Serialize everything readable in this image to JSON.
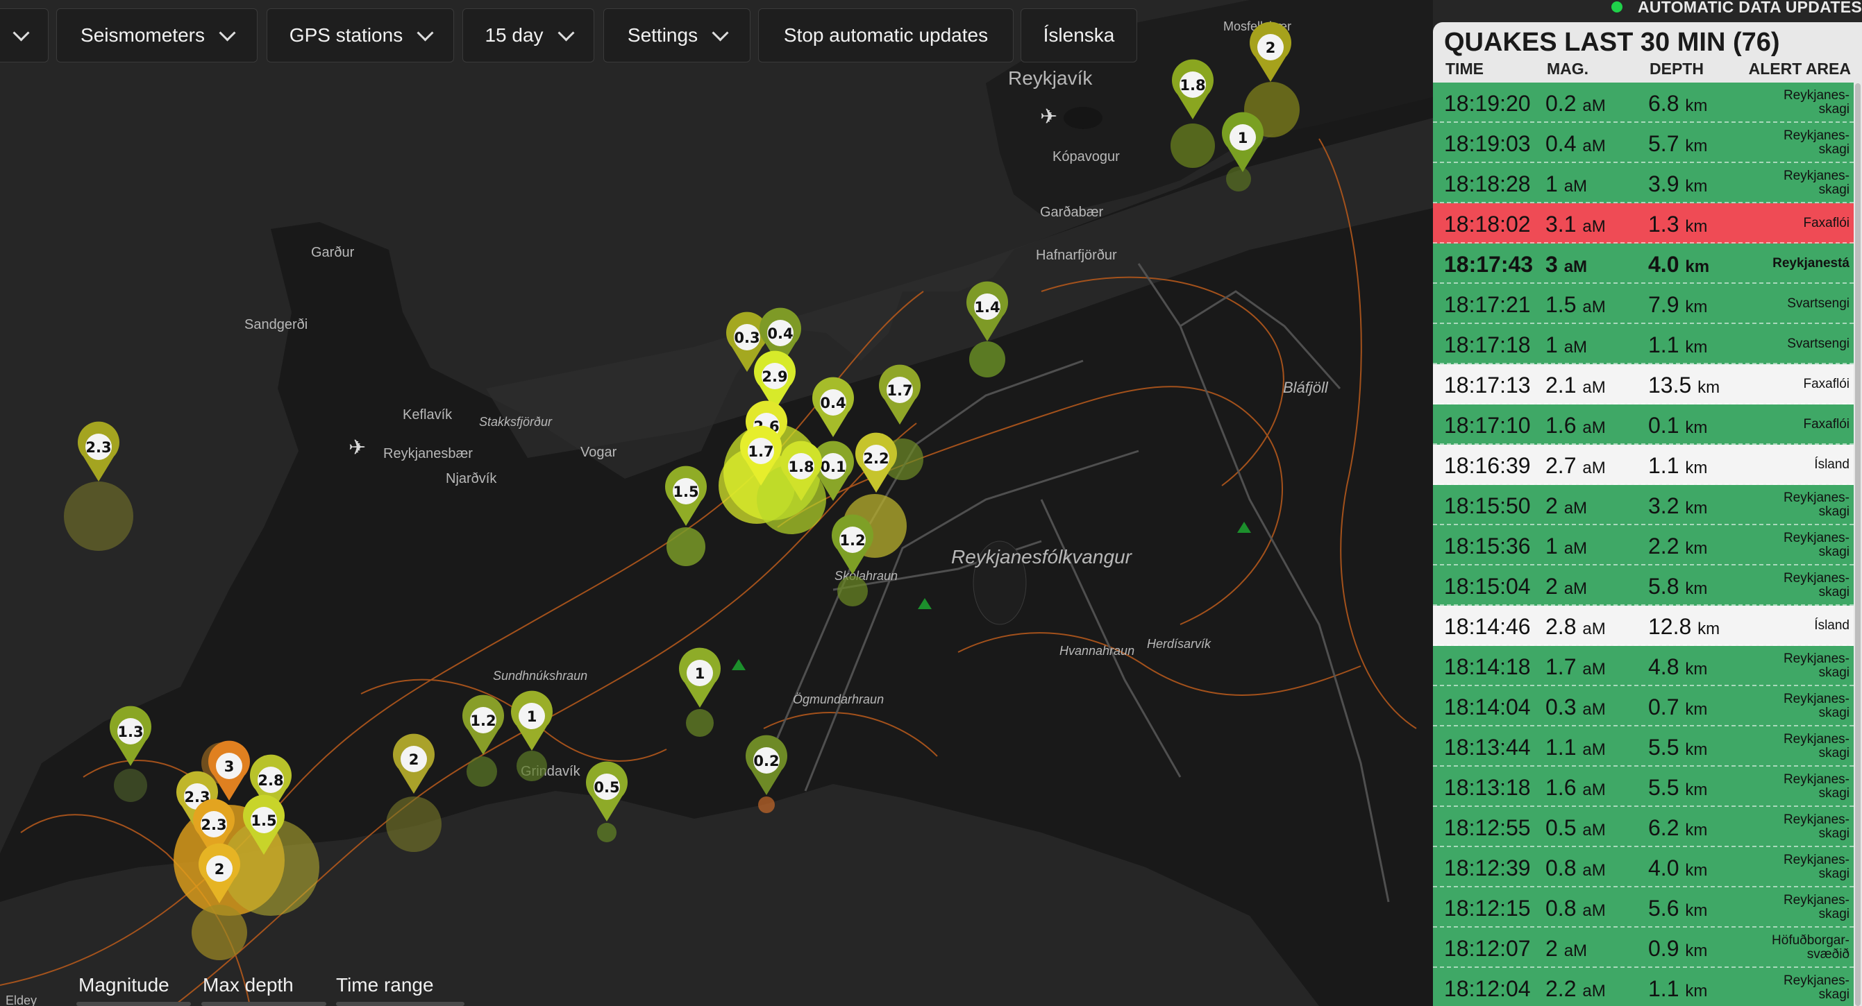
{
  "toolbar": {
    "buttons": [
      {
        "label": "",
        "x": 0
      },
      {
        "label": "Seismometers"
      },
      {
        "label": "GPS stations"
      },
      {
        "label": "15 day"
      },
      {
        "label": "Settings"
      },
      {
        "label": "Stop automatic updates"
      },
      {
        "label": "Íslenska"
      }
    ]
  },
  "status": {
    "label": "AUTOMATIC DATA UPDATES",
    "color": "#1fd14a"
  },
  "panel": {
    "title": "QUAKES LAST 30 MIN (76)",
    "columns": {
      "time": "TIME",
      "mag": "MAG.",
      "depth": "DEPTH",
      "area": "ALERT AREA"
    },
    "rows": [
      {
        "time": "18:19:20",
        "mag": "0.2",
        "depth": "6.8",
        "area": "Reykjanes-skagi",
        "style": "green"
      },
      {
        "time": "18:19:03",
        "mag": "0.4",
        "depth": "5.7",
        "area": "Reykjanes-skagi",
        "style": "green"
      },
      {
        "time": "18:18:28",
        "mag": "1",
        "depth": "3.9",
        "area": "Reykjanes-skagi",
        "style": "green"
      },
      {
        "time": "18:18:02",
        "mag": "3.1",
        "depth": "1.3",
        "area": "Faxaflói",
        "style": "red"
      },
      {
        "time": "18:17:43",
        "mag": "3",
        "depth": "4.0",
        "area": "Reykjanestá",
        "style": "green bold"
      },
      {
        "time": "18:17:21",
        "mag": "1.5",
        "depth": "7.9",
        "area": "Svartsengi",
        "style": "green"
      },
      {
        "time": "18:17:18",
        "mag": "1",
        "depth": "1.1",
        "area": "Svartsengi",
        "style": "green"
      },
      {
        "time": "18:17:13",
        "mag": "2.1",
        "depth": "13.5",
        "area": "Faxaflói",
        "style": "white"
      },
      {
        "time": "18:17:10",
        "mag": "1.6",
        "depth": "0.1",
        "area": "Faxaflói",
        "style": "green"
      },
      {
        "time": "18:16:39",
        "mag": "2.7",
        "depth": "1.1",
        "area": "Ísland",
        "style": "white"
      },
      {
        "time": "18:15:50",
        "mag": "2",
        "depth": "3.2",
        "area": "Reykjanes-skagi",
        "style": "green"
      },
      {
        "time": "18:15:36",
        "mag": "1",
        "depth": "2.2",
        "area": "Reykjanes-skagi",
        "style": "green"
      },
      {
        "time": "18:15:04",
        "mag": "2",
        "depth": "5.8",
        "area": "Reykjanes-skagi",
        "style": "green"
      },
      {
        "time": "18:14:46",
        "mag": "2.8",
        "depth": "12.8",
        "area": "Ísland",
        "style": "white"
      },
      {
        "time": "18:14:18",
        "mag": "1.7",
        "depth": "4.8",
        "area": "Reykjanes-skagi",
        "style": "green"
      },
      {
        "time": "18:14:04",
        "mag": "0.3",
        "depth": "0.7",
        "area": "Reykjanes-skagi",
        "style": "green"
      },
      {
        "time": "18:13:44",
        "mag": "1.1",
        "depth": "5.5",
        "area": "Reykjanes-skagi",
        "style": "green"
      },
      {
        "time": "18:13:18",
        "mag": "1.6",
        "depth": "5.5",
        "area": "Reykjanes-skagi",
        "style": "green"
      },
      {
        "time": "18:12:55",
        "mag": "0.5",
        "depth": "6.2",
        "area": "Reykjanes-skagi",
        "style": "green"
      },
      {
        "time": "18:12:39",
        "mag": "0.8",
        "depth": "4.0",
        "area": "Reykjanes-skagi",
        "style": "green"
      },
      {
        "time": "18:12:15",
        "mag": "0.8",
        "depth": "5.6",
        "area": "Reykjanes-skagi",
        "style": "green"
      },
      {
        "time": "18:12:07",
        "mag": "2",
        "depth": "0.9",
        "area": "Höfuðborgar-svæðið",
        "style": "green"
      },
      {
        "time": "18:12:04",
        "mag": "2.2",
        "depth": "1.1",
        "area": "Reykjanes-skagi",
        "style": "green"
      }
    ],
    "mag_unit": "aM",
    "depth_unit": "km"
  },
  "legend": {
    "magnitude": "Magnitude",
    "max_depth": "Max depth",
    "time_range": "Time range"
  },
  "map": {
    "places": [
      "Reykjavík",
      "Kópavogur",
      "Garðabær",
      "Hafnarfjörður",
      "Mosfellsbær",
      "Garður",
      "Sandgerði",
      "Keflavík",
      "Reykjanesbær",
      "Njarðvík",
      "Vogar",
      "Stakksfjörður",
      "Reykjanesfólkvangur",
      "Bláfjöll",
      "Hvannahraun",
      "Herdísarvík",
      "Sundhnúkshraun",
      "Ögmundarhraun",
      "Grindavík",
      "Skólahraun",
      "Eldey"
    ],
    "quake_labels": [
      "2",
      "1.8",
      "1",
      "1.4",
      "0.3",
      "0.4",
      "2.9",
      "0.4",
      "1.7",
      "2.6",
      "1.7",
      "0.1",
      "1.8",
      "2.2",
      "1.5",
      "1.2",
      "2.3",
      "1.3",
      "3",
      "2.8",
      "2.3",
      "2.3",
      "1.5",
      "2",
      "2",
      "1.2",
      "1",
      "1",
      "0.5",
      "0.2"
    ]
  }
}
